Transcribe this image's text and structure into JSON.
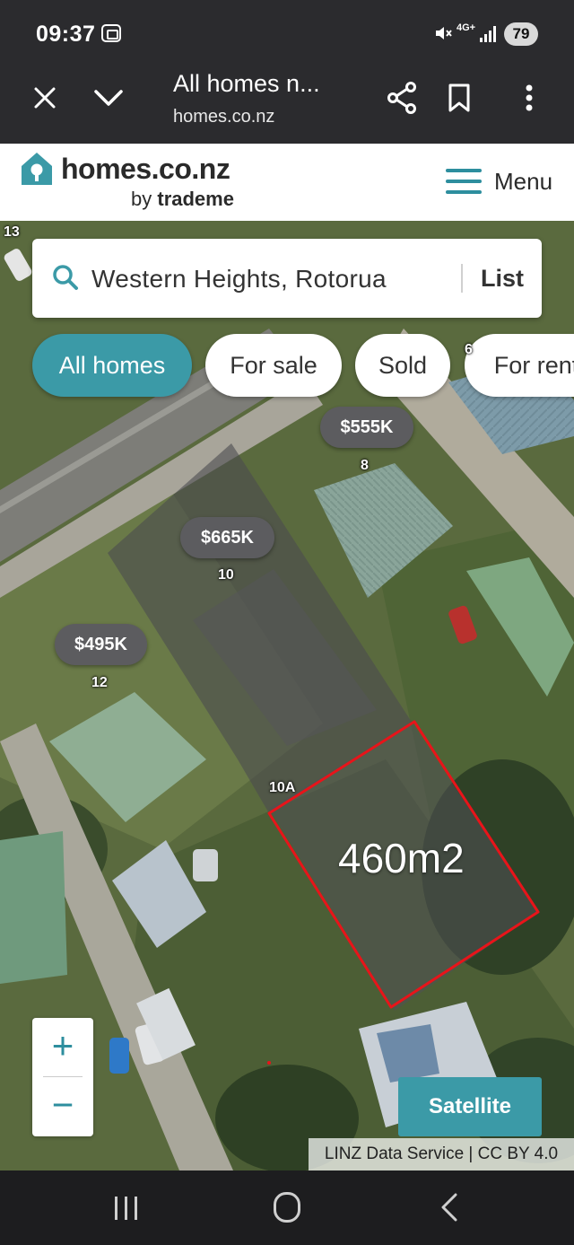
{
  "status_bar": {
    "time": "09:37",
    "network": "4G+",
    "battery": "79"
  },
  "browser_bar": {
    "page_title": "All homes n...",
    "url": "homes.co.nz"
  },
  "site_header": {
    "logo_main": "homes.co.nz",
    "logo_by": "by",
    "logo_brand": "trademe",
    "menu_label": "Menu",
    "brand_color": "#3b9aa7"
  },
  "search": {
    "query": "Western Heights, Rotorua",
    "list_label": "List"
  },
  "filters": [
    {
      "label": "All homes",
      "active": true
    },
    {
      "label": "For sale",
      "active": false
    },
    {
      "label": "Sold",
      "active": false
    },
    {
      "label": "For rent",
      "active": false
    }
  ],
  "map": {
    "price_markers": [
      {
        "price": "$555K",
        "number": "8"
      },
      {
        "price": "$665K",
        "number": "10"
      },
      {
        "price": "$495K",
        "number": "12"
      }
    ],
    "street_numbers": [
      "13",
      "6",
      "10A"
    ],
    "annotation": "460m2",
    "annotation_color": "#e8141a",
    "zoom_in": "+",
    "zoom_out": "−",
    "layer_button": "Satellite",
    "attribution": "LINZ Data Service | CC BY 4.0"
  }
}
